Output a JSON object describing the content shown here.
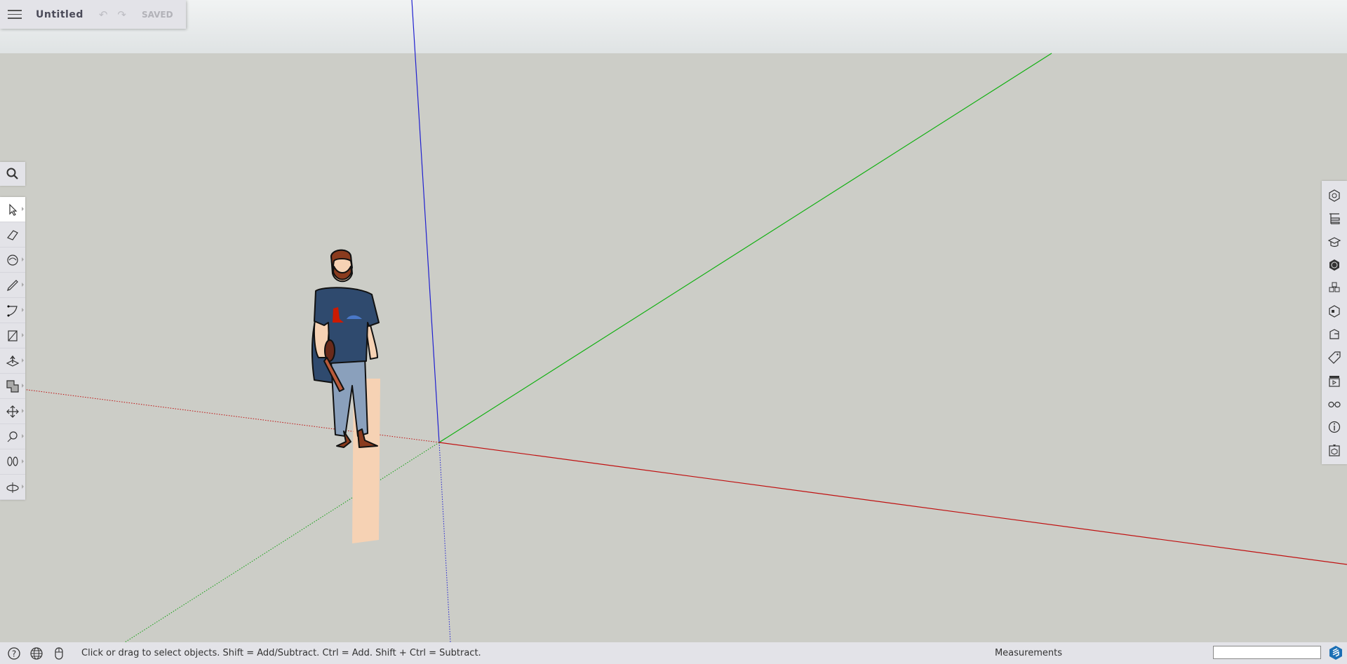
{
  "header": {
    "title": "Untitled",
    "status": "SAVED",
    "undo_icon": "undo-icon",
    "redo_icon": "redo-icon",
    "menu_icon": "hamburger-menu-icon"
  },
  "left_toolbar": {
    "search_icon": "search-icon",
    "tools": [
      {
        "name": "select",
        "icon": "arrow-cursor-icon",
        "active": true
      },
      {
        "name": "eraser",
        "icon": "eraser-icon"
      },
      {
        "name": "paint",
        "icon": "paint-bucket-icon"
      },
      {
        "name": "line",
        "icon": "pencil-icon"
      },
      {
        "name": "arc",
        "icon": "arc-icon"
      },
      {
        "name": "rectangle",
        "icon": "rectangle-icon"
      },
      {
        "name": "push-pull",
        "icon": "push-pull-icon"
      },
      {
        "name": "offset",
        "icon": "offset-icon"
      },
      {
        "name": "move",
        "icon": "move-icon"
      },
      {
        "name": "tape-measure",
        "icon": "tape-measure-icon"
      },
      {
        "name": "walk",
        "icon": "footprints-icon"
      },
      {
        "name": "orbit",
        "icon": "orbit-icon"
      }
    ]
  },
  "right_panels": [
    "entity-info-icon",
    "outliner-icon",
    "instructor-icon",
    "materials-icon",
    "components-icon",
    "styles-icon",
    "scenes-3d-icon",
    "tags-icon",
    "scenes-icon",
    "display-icon",
    "info-icon",
    "3d-warehouse-icon"
  ],
  "status_bar": {
    "hint": "Click or drag to select objects. Shift = Add/Subtract. Ctrl = Add. Shift + Ctrl = Subtract.",
    "measurements_label": "Measurements",
    "measurements_value": ""
  },
  "colors": {
    "red_axis": "#cc0000",
    "green_axis": "#00b000",
    "blue_axis": "#0000cc",
    "ground": "#cccdc7",
    "brand": "#1b6fb5"
  }
}
